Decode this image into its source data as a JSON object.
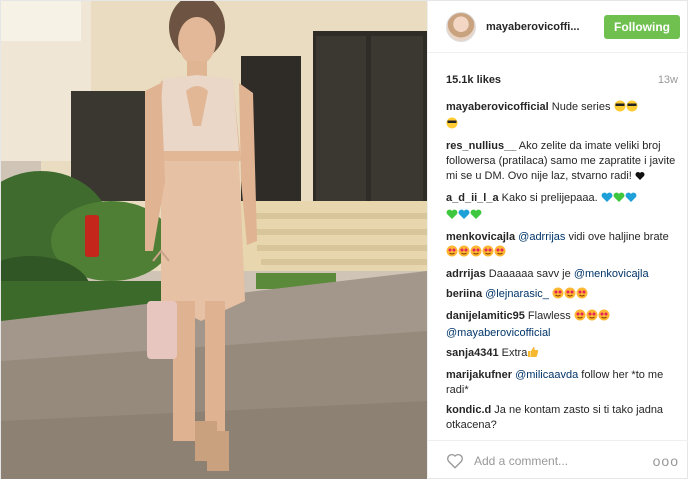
{
  "post": {
    "username": "mayaberovicoffi...",
    "follow_label": "Following",
    "likes": "15.1k likes",
    "time_ago": "13w",
    "caption": {
      "user": "mayaberovicofficial",
      "text": " Nude series"
    },
    "comments": [
      {
        "user": "res_nullius__",
        "text": " Ako zelite da imate veliki broj followersa (pratilaca) samo me zapratite i javite mi se u DM. Ovo nije laz, stvarno radi! "
      },
      {
        "user": "a_d_ii_l_a",
        "text": " Kako si prelijepaaa."
      },
      {
        "user": "menkovicajla",
        "mention": "@adrrijas",
        "text": " vidi ove haljine brate"
      },
      {
        "user": "adrrijas",
        "text": " Daaaaaa savv je ",
        "mention": "@menkovicajla"
      },
      {
        "user": "beriina",
        "mention": "@lejnarasic_",
        "text": ""
      },
      {
        "user": "danijelamitic95",
        "text": " Flawless ",
        "mention": "@mayaberovicofficial"
      },
      {
        "user": "sanja4341",
        "text": " Extra"
      },
      {
        "user": "marijakufner",
        "mention": "@milicaavda",
        "text": " follow her *to me radi*"
      },
      {
        "user": "kondic.d",
        "text": " Ja ne kontam zasto si ti tako jadna otkacena?"
      }
    ],
    "add_comment_placeholder": "Add a comment...",
    "more_label": "ooo"
  },
  "colors": {
    "follow": "#70c050",
    "mention": "#003569",
    "muted": "#999999"
  },
  "icons": [
    "heart-icon",
    "more-options-icon",
    "sunglasses-emoji",
    "blue-heart-emoji",
    "green-heart-emoji",
    "black-heart-emoji",
    "heart-eyes-emoji",
    "thumbs-up-emoji"
  ]
}
